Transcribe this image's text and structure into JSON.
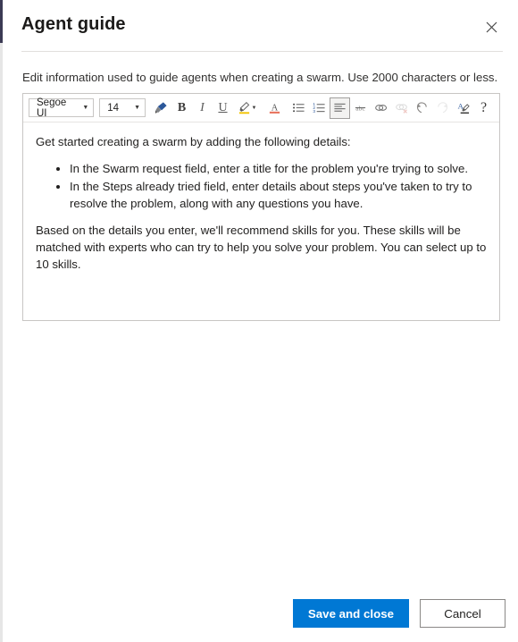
{
  "window": {
    "title": "Agent guide",
    "close_label": "Close",
    "close_icon": "close-icon"
  },
  "description": "Edit information used to guide agents when creating a swarm. Use 2000 characters or less.",
  "editor": {
    "font_family_value": "Segoe UI",
    "font_size_value": "14",
    "toolbar": [
      {
        "name": "format-painter-icon",
        "tooltip": "Format painter",
        "state": "enabled"
      },
      {
        "name": "bold-icon",
        "tooltip": "Bold",
        "state": "enabled"
      },
      {
        "name": "italic-icon",
        "tooltip": "Italic",
        "state": "enabled"
      },
      {
        "name": "underline-icon",
        "tooltip": "Underline",
        "state": "enabled"
      },
      {
        "name": "highlight-color-icon",
        "tooltip": "Highlight",
        "state": "enabled"
      },
      {
        "name": "font-color-icon",
        "tooltip": "Font color",
        "state": "enabled"
      },
      {
        "name": "bulleted-list-icon",
        "tooltip": "Bulleted list",
        "state": "enabled"
      },
      {
        "name": "numbered-list-icon",
        "tooltip": "Numbered list",
        "state": "enabled"
      },
      {
        "name": "align-left-icon",
        "tooltip": "Align left",
        "state": "active"
      },
      {
        "name": "strikethrough-icon",
        "tooltip": "Strikethrough",
        "state": "enabled"
      },
      {
        "name": "insert-link-icon",
        "tooltip": "Insert link",
        "state": "enabled"
      },
      {
        "name": "remove-link-icon",
        "tooltip": "Remove link",
        "state": "disabled"
      },
      {
        "name": "undo-icon",
        "tooltip": "Undo",
        "state": "enabled"
      },
      {
        "name": "redo-icon",
        "tooltip": "Redo",
        "state": "disabled"
      },
      {
        "name": "clear-formatting-icon",
        "tooltip": "Clear formatting",
        "state": "enabled"
      },
      {
        "name": "help-icon",
        "tooltip": "Help",
        "state": "enabled"
      }
    ],
    "content": {
      "intro": "Get started creating a swarm by adding the following details:",
      "bullets": [
        "In the Swarm request field, enter a title for the problem you're trying to solve.",
        "In the Steps already tried field, enter details about steps you've taken to try to resolve the problem, along with any questions you have."
      ],
      "outro": "Based on the details you enter, we'll recommend skills for you. These skills will be matched with experts who can try to help you solve your problem. You can select up to 10 skills."
    }
  },
  "footer": {
    "save_label": "Save and close",
    "cancel_label": "Cancel"
  },
  "colors": {
    "accent": "#0078d4",
    "title": "#1b1a19",
    "border": "#c8c6c4",
    "edge_dark": "#3b3a54"
  }
}
